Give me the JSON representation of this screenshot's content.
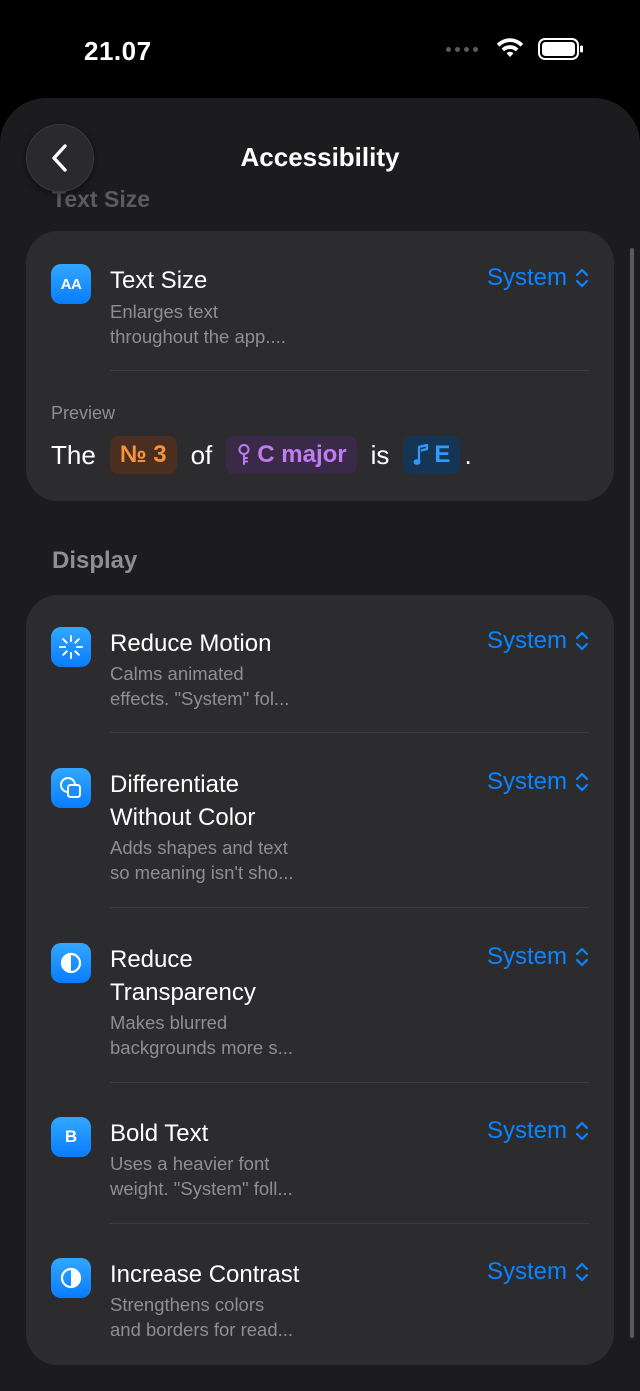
{
  "status": {
    "time": "21.07"
  },
  "nav": {
    "title": "Accessibility",
    "scrolled_header": "Text Size"
  },
  "text_size": {
    "title": "Text Size",
    "subtitle_line1": "Enlarges text",
    "subtitle_line2": "throughout the app....",
    "value": "System",
    "icon_label": "AA"
  },
  "preview": {
    "label": "Preview",
    "word1": "The",
    "chip1": "№ 3",
    "word2": "of",
    "chip2": "C major",
    "word3": "is",
    "chip3": "E",
    "end": "."
  },
  "display": {
    "header": "Display",
    "items": [
      {
        "title1": "Reduce Motion",
        "title2": "",
        "sub1": "Calms animated",
        "sub2": "effects. \"System\" fol...",
        "value": "System",
        "icon": "sparkle-icon"
      },
      {
        "title1": "Differentiate",
        "title2": "Without Color",
        "sub1": "Adds shapes and text",
        "sub2": "so meaning isn't sho...",
        "value": "System",
        "icon": "shapes-icon"
      },
      {
        "title1": "Reduce",
        "title2": "Transparency",
        "sub1": "Makes blurred",
        "sub2": "backgrounds more s...",
        "value": "System",
        "icon": "half-circle-icon"
      },
      {
        "title1": "Bold Text",
        "title2": "",
        "sub1": "Uses a heavier font",
        "sub2": "weight. \"System\" foll...",
        "value": "System",
        "icon": "bold-b-icon",
        "icon_label": "B"
      },
      {
        "title1": "Increase Contrast",
        "title2": "",
        "sub1": "Strengthens colors",
        "sub2": "and borders for read...",
        "value": "System",
        "icon": "contrast-icon"
      }
    ]
  },
  "colors": {
    "accent": "#0a84ff",
    "card": "#2c2c2e",
    "background": "#1c1c1e"
  }
}
